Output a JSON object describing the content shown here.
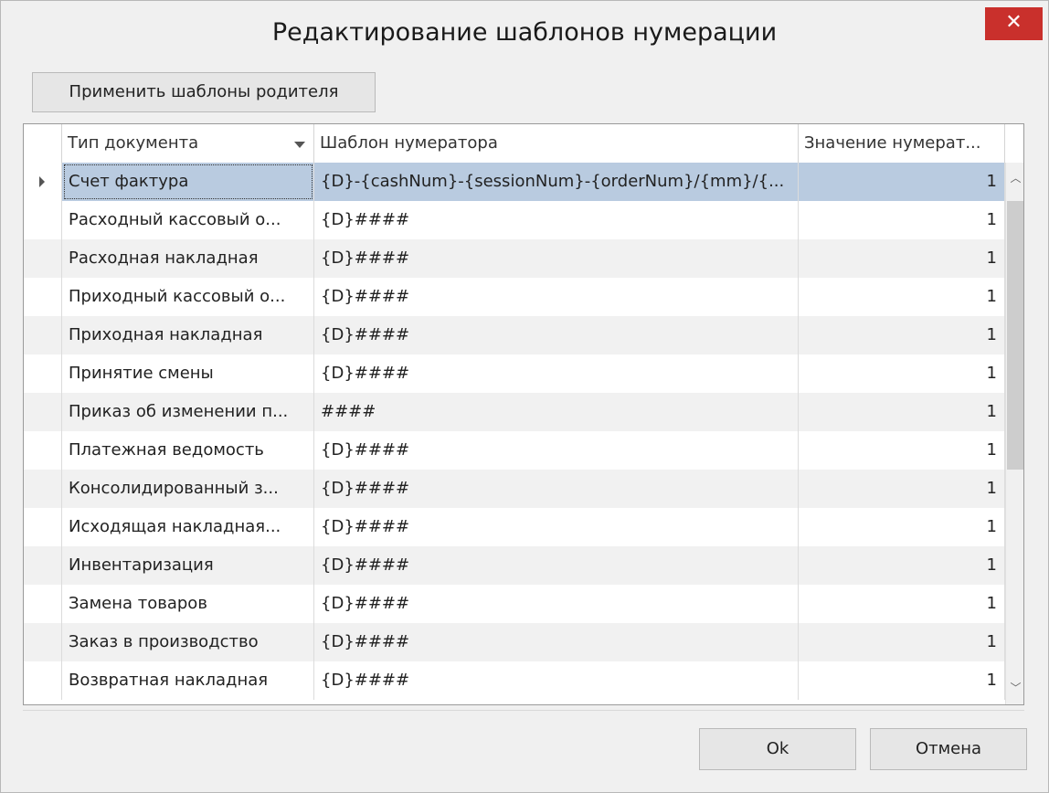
{
  "window": {
    "title": "Редактирование шаблонов нумерации",
    "close_label": "✕"
  },
  "toolbar": {
    "apply_parent_label": "Применить шаблоны родителя"
  },
  "grid": {
    "columns": [
      "Тип документа",
      "Шаблон нумератора",
      "Значение нумерат..."
    ],
    "rows": [
      {
        "type": "Счет фактура",
        "template": "{D}-{cashNum}-{sessionNum}-{orderNum}/{mm}/{...",
        "value": "1"
      },
      {
        "type": "Расходный кассовый о...",
        "template": "{D}####",
        "value": "1"
      },
      {
        "type": "Расходная накладная",
        "template": "{D}####",
        "value": "1"
      },
      {
        "type": "Приходный кассовый о...",
        "template": "{D}####",
        "value": "1"
      },
      {
        "type": "Приходная накладная",
        "template": "{D}####",
        "value": "1"
      },
      {
        "type": "Принятие смены",
        "template": "{D}####",
        "value": "1"
      },
      {
        "type": "Приказ об изменении п...",
        "template": "####",
        "value": "1"
      },
      {
        "type": "Платежная ведомость",
        "template": "{D}####",
        "value": "1"
      },
      {
        "type": "Консолидированный з...",
        "template": "{D}####",
        "value": "1"
      },
      {
        "type": "Исходящая накладная...",
        "template": "{D}####",
        "value": "1"
      },
      {
        "type": "Инвентаризация",
        "template": "{D}####",
        "value": "1"
      },
      {
        "type": "Замена товаров",
        "template": "{D}####",
        "value": "1"
      },
      {
        "type": "Заказ в производство",
        "template": "{D}####",
        "value": "1"
      },
      {
        "type": "Возвратная накладная",
        "template": "{D}####",
        "value": "1"
      }
    ]
  },
  "footer": {
    "ok_label": "Ok",
    "cancel_label": "Отмена"
  }
}
